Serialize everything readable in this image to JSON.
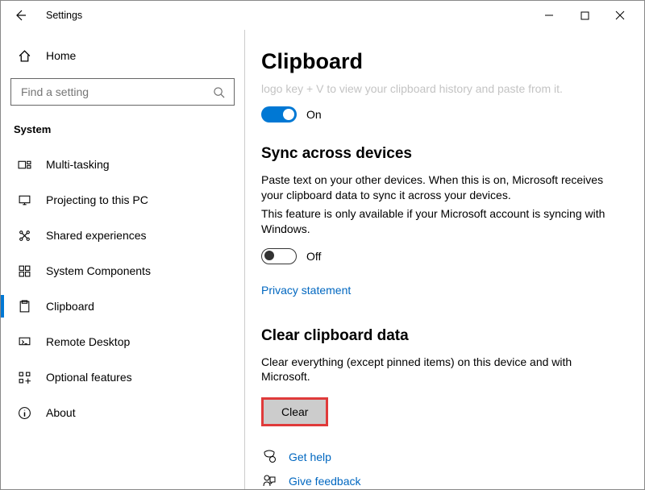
{
  "window": {
    "title": "Settings"
  },
  "sidebar": {
    "home": "Home",
    "search_placeholder": "Find a setting",
    "section": "System",
    "items": [
      {
        "label": "Multi-tasking"
      },
      {
        "label": "Projecting to this PC"
      },
      {
        "label": "Shared experiences"
      },
      {
        "label": "System Components"
      },
      {
        "label": "Clipboard",
        "selected": true
      },
      {
        "label": "Remote Desktop"
      },
      {
        "label": "Optional features"
      },
      {
        "label": "About"
      }
    ]
  },
  "content": {
    "page_title": "Clipboard",
    "truncated": "logo key + V to view your clipboard history and paste from it.",
    "history_toggle": {
      "state": "On"
    },
    "sync": {
      "heading": "Sync across devices",
      "p1": "Paste text on your other devices. When this is on, Microsoft receives your clipboard data to sync it across your devices.",
      "p2": "This feature is only available if your Microsoft account is syncing with Windows.",
      "toggle": {
        "state": "Off"
      },
      "link": "Privacy statement"
    },
    "clear": {
      "heading": "Clear clipboard data",
      "desc": "Clear everything (except pinned items) on this device and with Microsoft.",
      "button": "Clear"
    },
    "footer": {
      "help": "Get help",
      "feedback": "Give feedback"
    }
  }
}
